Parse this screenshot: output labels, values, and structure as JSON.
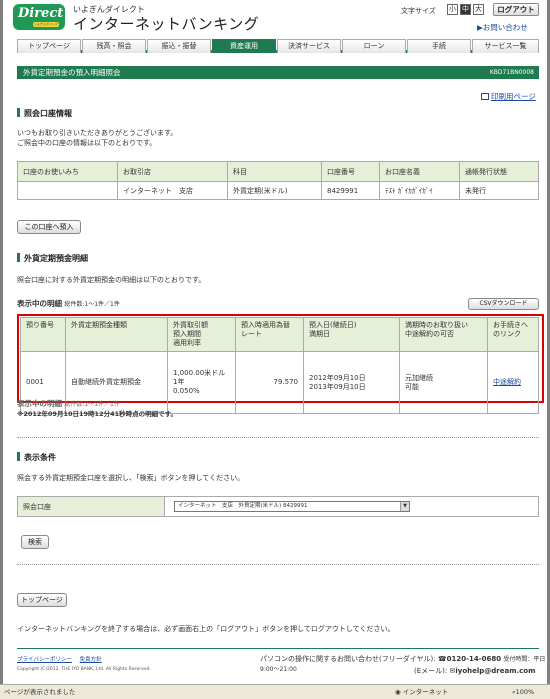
{
  "header": {
    "logo_main": "Direct",
    "logo_sub": "いよぎんダイレクト",
    "brand_sub": "いよぎんダイレクト",
    "brand_main": "インターネットバンキング",
    "font_size_label": "文字サイズ",
    "font_sizes": [
      "小",
      "中",
      "大"
    ],
    "logout": "ログアウト",
    "contact": "お問い合わせ"
  },
  "nav": {
    "tabs": [
      "トップページ",
      "残高・照会",
      "振込・振替",
      "資産運用",
      "決済サービス",
      "ローン",
      "手続",
      "サービス一覧"
    ],
    "active_index": 3
  },
  "page": {
    "title": "外貨定期預金の預入明細照会",
    "code": "KBD71BN0008",
    "print_link": "印刷用ページ"
  },
  "account_section": {
    "heading": "照会口座情報",
    "intro_1": "いつもお取り引きいただきありがとうございます。",
    "intro_2": "ご照会中の口座の情報は以下のとおりです。",
    "columns": [
      "口座のお使いみち",
      "お取引店",
      "科目",
      "口座番号",
      "お口座名義",
      "通帳発行状態"
    ],
    "row": [
      "",
      "インターネット　支店",
      "外貨定期(米ドル)",
      "8429991",
      "ﾃｽﾄ ｶﾞｲｶｶﾞｲｶﾞｲ",
      "未発行"
    ],
    "deposit_button": "この口座へ預入"
  },
  "deposit_section": {
    "heading": "外貨定期預金明細",
    "intro": "照会口座に対する外貨定期預金の明細は以下のとおりです。",
    "showing_label": "表示中の明細",
    "showing_count": "総件数:1～1件／1件",
    "csv_button": "CSVダウンロード",
    "columns": [
      [
        "預り番号"
      ],
      [
        "外貨定期預金種類"
      ],
      [
        "外貨取引額",
        "預入期間",
        "適用利率"
      ],
      [
        "預入時適用為替",
        "レート"
      ],
      [
        "預入日(継続日)",
        "満期日"
      ],
      [
        "満期時のお取り扱い",
        "中途解約の可否"
      ],
      [
        "お手続きへ",
        "のリンク"
      ]
    ],
    "row": {
      "number": "0001",
      "type": "自動継続外貨定期預金",
      "amount": "1,000.00米ドル",
      "term": "1年",
      "rate": "0.050%",
      "fx_rate": "79.570",
      "deposit_date": "2012年09月10日",
      "maturity_date": "2013年09月10日",
      "maturity_handling": "元加継続",
      "cancel_ok": "可能",
      "action_link": "中途解約"
    },
    "footer_count": "総件数:1～1件／1件",
    "as_of": "※2012年09月10日19時12分41秒時点の明細です。"
  },
  "condition_section": {
    "heading": "表示条件",
    "intro": "照会する外貨定期預金口座を選択し、「検索」ボタンを押してください。",
    "field_label": "照会口座",
    "select_value": "インターネット　支店　外貨定期(米ドル) 8429991",
    "search_button": "検索"
  },
  "top_button": "トップページ",
  "notice": "インターネットバンキングを終了する場合は、必ず画面右上の「ログアウト」ボタンを押してログアウトしてください。",
  "footer": {
    "privacy": "プライバシーポリシー",
    "disclaimer": "免責方針",
    "copyright": "Copyright (C)2012, THE IYO BANK, Ltd. All Rights Reserved.",
    "support_label": "パソコンの操作に関するお問い合わせ(フリーダイヤル):",
    "phone": "0120-14-0680",
    "hours": "受付時間：平日9:00～21:00",
    "email_label": "(Eメール):",
    "email": "iyohelp@dream.com"
  },
  "statusbar": {
    "left": "ページが表示されました",
    "zone": "インターネット",
    "zoom": "100%"
  }
}
